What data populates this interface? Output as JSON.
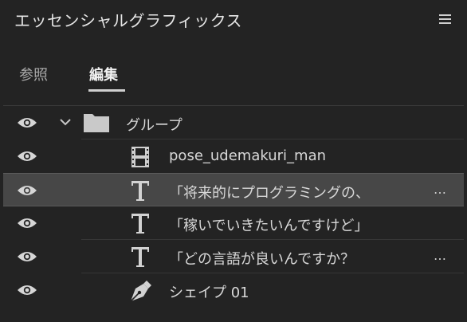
{
  "panel": {
    "title": "エッセンシャルグラフィックス",
    "menu_icon": "hamburger-menu-icon"
  },
  "tabs": [
    {
      "label": "参照",
      "active": false
    },
    {
      "label": "編集",
      "active": true
    }
  ],
  "layers": [
    {
      "name": "グループ",
      "type": "group",
      "icon": "folder-icon",
      "visible": true,
      "expanded": true
    },
    {
      "name": "pose_udemakuri_man",
      "type": "video",
      "icon": "film-icon",
      "visible": true
    },
    {
      "name": "「将来的にプログラミングの、",
      "type": "text",
      "icon": "text-type-icon",
      "visible": true,
      "selected": true,
      "truncated": true,
      "ellipsis": "…"
    },
    {
      "name": "「稼いでいきたいんですけど」",
      "type": "text",
      "icon": "text-type-icon",
      "visible": true
    },
    {
      "name": "「どの言語が良いんですか？",
      "type": "text",
      "icon": "text-type-icon",
      "visible": true,
      "truncated": true,
      "ellipsis": "…"
    },
    {
      "name": "シェイプ 01",
      "type": "shape",
      "icon": "pen-tool-icon",
      "visible": true
    }
  ],
  "colors": {
    "panel_bg": "#232323",
    "selected_row_bg": "#474747",
    "text": "#d8d8d8"
  }
}
